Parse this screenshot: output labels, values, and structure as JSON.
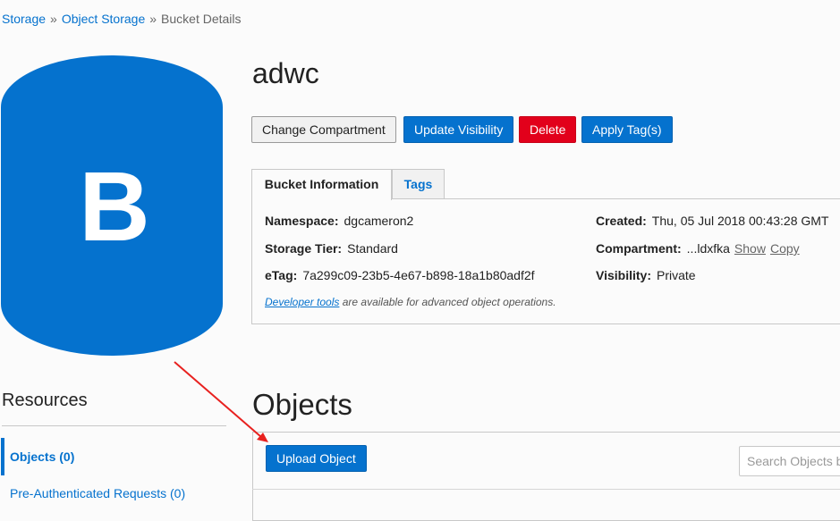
{
  "breadcrumb": {
    "items": [
      "Storage",
      "Object Storage",
      "Bucket Details"
    ],
    "separator": "»"
  },
  "bucket_icon": {
    "letter": "B",
    "color": "#0572ce",
    "icon": "bucket-cylinder-icon"
  },
  "title": "adwc",
  "actions": {
    "change_compartment": "Change Compartment",
    "update_visibility": "Update Visibility",
    "delete": "Delete",
    "apply_tags": "Apply Tag(s)"
  },
  "tabs": [
    {
      "label": "Bucket Information",
      "active": true
    },
    {
      "label": "Tags",
      "active": false
    }
  ],
  "bucket_info": {
    "namespace": {
      "label": "Namespace:",
      "value": "dgcameron2"
    },
    "storage_tier": {
      "label": "Storage Tier:",
      "value": "Standard"
    },
    "etag": {
      "label": "eTag:",
      "value": "7a299c09-23b5-4e67-b898-18a1b80adf2f"
    },
    "created": {
      "label": "Created:",
      "value": "Thu, 05 Jul 2018 00:43:28 GMT"
    },
    "compartment": {
      "label": "Compartment:",
      "value": "...ldxfka",
      "show": "Show",
      "copy": "Copy"
    },
    "visibility": {
      "label": "Visibility:",
      "value": "Private"
    }
  },
  "developer_note": {
    "link": "Developer tools",
    "text": " are available for advanced object operations."
  },
  "resources": {
    "heading": "Resources",
    "items": [
      {
        "label": "Objects (0)",
        "active": true
      },
      {
        "label": "Pre-Authenticated Requests (0)",
        "active": false
      }
    ]
  },
  "objects": {
    "heading": "Objects",
    "upload_label": "Upload Object",
    "search_placeholder": "Search Objects b"
  },
  "colors": {
    "primary": "#0572ce",
    "danger": "#e2001b",
    "annotation_arrow": "#e8211f"
  }
}
